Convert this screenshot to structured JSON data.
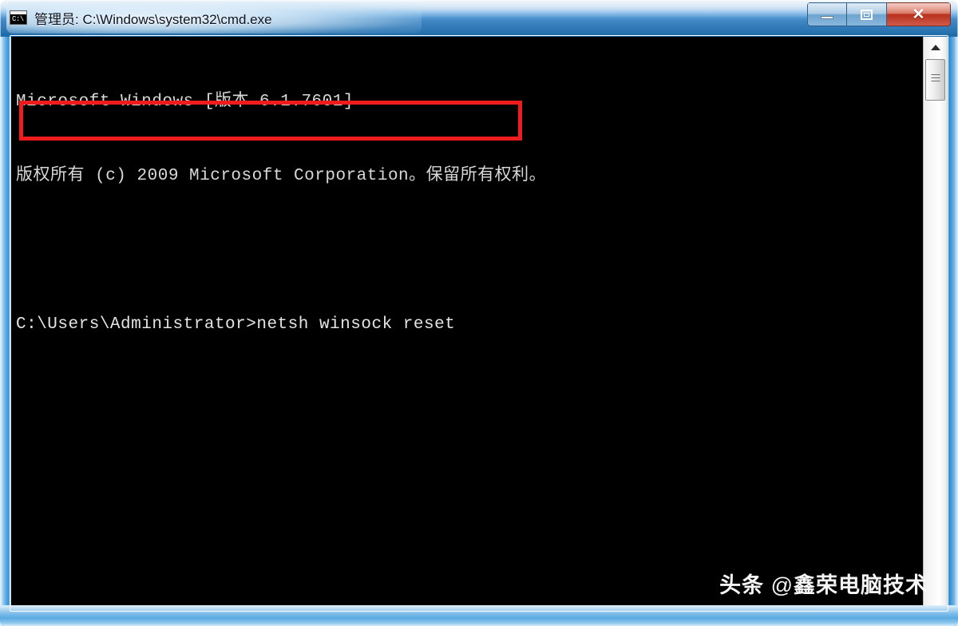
{
  "window": {
    "title": "管理员: C:\\Windows\\system32\\cmd.exe",
    "icon_name": "cmd-icon",
    "icon_text": "C:\\",
    "controls": {
      "minimize_label": "—",
      "restore_label": "❐",
      "close_label": "✕",
      "close_color": "#b8321c",
      "titlebar_color": "#1d6aa6"
    }
  },
  "console": {
    "background_color": "#000000",
    "text_color": "#d8d8d8",
    "lines": [
      "Microsoft Windows [版本 6.1.7601]",
      "版权所有 (c) 2009 Microsoft Corporation。保留所有权利。",
      "",
      "C:\\Users\\Administrator>netsh winsock reset"
    ],
    "prompt": "C:\\Users\\Administrator>",
    "command": "netsh winsock reset"
  },
  "annotation": {
    "type": "red-rectangle-highlight",
    "color": "#ee1c1c",
    "targets_line": "C:\\Users\\Administrator>netsh winsock reset"
  },
  "scrollbar": {
    "up_arrow": "▲",
    "thumb_grip": "≡",
    "orientation": "vertical"
  },
  "watermark": {
    "platform": "头条",
    "at": "@",
    "account": "鑫荣电脑技术"
  }
}
